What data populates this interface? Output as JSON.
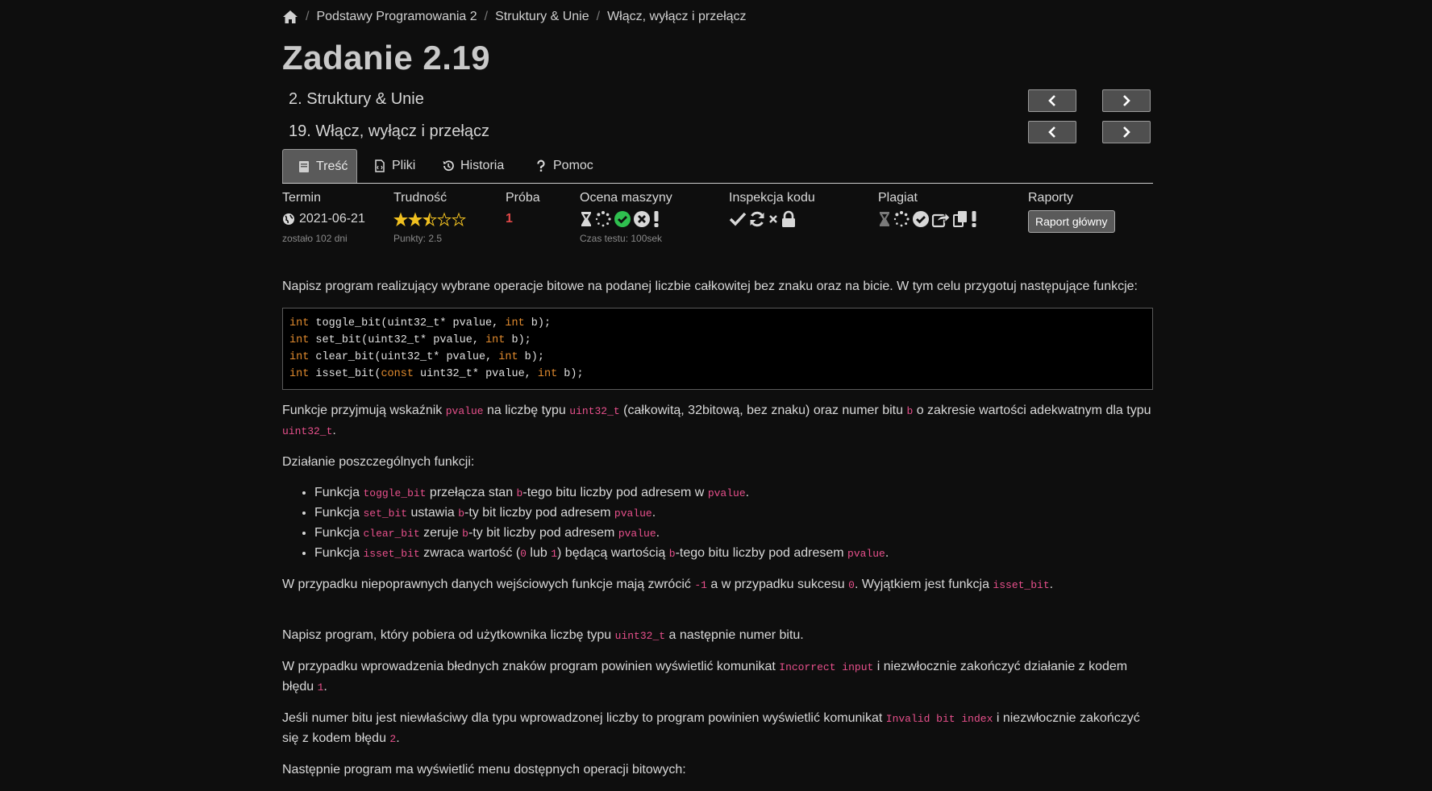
{
  "breadcrumb": {
    "items": [
      "Podstawy Programowania 2",
      "Struktury & Unie",
      "Włącz, wyłącz i przełącz"
    ],
    "separator": "/"
  },
  "title": "Zadanie 2.19",
  "subtitles": [
    "2. Struktury & Unie",
    "19. Włącz, wyłącz i przełącz"
  ],
  "tabs": [
    {
      "label": "Treść",
      "icon": "book-icon",
      "active": true
    },
    {
      "label": "Pliki",
      "icon": "file-code-icon",
      "active": false
    },
    {
      "label": "Historia",
      "icon": "history-icon",
      "active": false
    },
    {
      "label": "Pomoc",
      "icon": "question-icon",
      "active": false
    }
  ],
  "meta": {
    "termin": {
      "label": "Termin",
      "value": "2021-06-21",
      "note": "zostało 102 dni",
      "icon": "globe-icon"
    },
    "trudnosc": {
      "label": "Trudność",
      "stars_filled": 2.5,
      "stars_total": 5,
      "note": "Punkty: 2.5",
      "star_color": "#f0c020"
    },
    "proba": {
      "label": "Próba",
      "value": "1",
      "color": "#e04848"
    },
    "ocena": {
      "label": "Ocena maszyny",
      "icons": [
        "hourglass-icon",
        "spinner-icon",
        "check-circle-icon",
        "x-circle-icon",
        "exclamation-icon"
      ],
      "note": "Czas testu: 100sek"
    },
    "inspekcja": {
      "label": "Inspekcja kodu",
      "icons": [
        "check-icon",
        "refresh-icon",
        "times-icon",
        "lock-icon"
      ]
    },
    "plagiat": {
      "label": "Plagiat",
      "icons": [
        "hourglass-icon",
        "spinner-icon",
        "check-circle-icon",
        "share-icon",
        "copy-icon",
        "exclamation-icon"
      ]
    },
    "raporty": {
      "label": "Raporty",
      "button": "Raport główny"
    }
  },
  "content": {
    "p1": "Napisz program realizujący wybrane operacje bitowe na podanej liczbie całkowitej bez znaku oraz na bicie. W tym celu przygotuj następujące funkcje:",
    "code_lines": [
      {
        "kw": "int",
        "rest": " toggle_bit(uint32_t* pvalue, ",
        "kw2": "int",
        "tail": " b);"
      },
      {
        "kw": "int",
        "rest": " set_bit(uint32_t* pvalue, ",
        "kw2": "int",
        "tail": " b);"
      },
      {
        "kw": "int",
        "rest": " clear_bit(uint32_t* pvalue, ",
        "kw2": "int",
        "tail": " b);"
      },
      {
        "kw": "int",
        "rest": " isset_bit(",
        "kwc": "const",
        "rest2": " uint32_t* pvalue, ",
        "kw2": "int",
        "tail": " b);"
      }
    ],
    "p2": {
      "t1": "Funkcje przyjmują wskaźnik ",
      "c1": "pvalue",
      "t2": " na liczbę typu ",
      "c2": "uint32_t",
      "t3": " (całkowitą, 32bitową, bez znaku) oraz numer bitu ",
      "c3": "b",
      "t4": " o zakresie wartości adekwatnym dla typu ",
      "c4": "uint32_t",
      "t5": "."
    },
    "p3": "Działanie poszczególnych funkcji:",
    "list": [
      {
        "a": "Funkcja ",
        "c1": "toggle_bit",
        "b": " przełącza stan ",
        "c2": "b",
        "c": "-tego bitu liczby pod adresem w ",
        "c3": "pvalue",
        "d": "."
      },
      {
        "a": "Funkcja ",
        "c1": "set_bit",
        "b": " ustawia ",
        "c2": "b",
        "c": "-ty bit liczby pod adresem ",
        "c3": "pvalue",
        "d": "."
      },
      {
        "a": "Funkcja ",
        "c1": "clear_bit",
        "b": " zeruje ",
        "c2": "b",
        "c": "-ty bit liczby pod adresem ",
        "c3": "pvalue",
        "d": "."
      },
      {
        "a": "Funkcja ",
        "c1": "isset_bit",
        "b": " zwraca wartość (",
        "c2": "0",
        "c": " lub ",
        "c3": "1",
        "d": ") będącą wartością ",
        "c4": "b",
        "e": "-tego bitu liczby pod adresem ",
        "c5": "pvalue",
        "f": "."
      }
    ],
    "p4": {
      "t1": "W przypadku niepoprawnych danych wejściowych funkcje mają zwrócić ",
      "c1": "-1",
      "t2": " a w przypadku sukcesu ",
      "c2": "0",
      "t3": ". Wyjątkiem jest funkcja ",
      "c3": "isset_bit",
      "t4": "."
    },
    "p5": {
      "t1": "Napisz program, który pobiera od użytkownika liczbę typu ",
      "c1": "uint32_t",
      "t2": " a następnie numer bitu."
    },
    "p6": {
      "t1": "W przypadku wprowadzenia błednych znaków program powinien wyświetlić komunikat ",
      "c1": "Incorrect input",
      "t2": " i niezwłocznie zakończyć działanie z kodem błędu ",
      "c2": "1",
      "t3": "."
    },
    "p7": {
      "t1": "Jeśli numer bitu jest niewłaściwy dla typu wprowadzonej liczby to program powinien wyświetlić komunikat ",
      "c1": "Invalid bit index",
      "t2": " i niezwłocznie zakończyć się z kodem błędu ",
      "c2": "2",
      "t3": "."
    },
    "p8": "Następnie program ma wyświetlić menu dostępnych operacji bitowych:"
  }
}
